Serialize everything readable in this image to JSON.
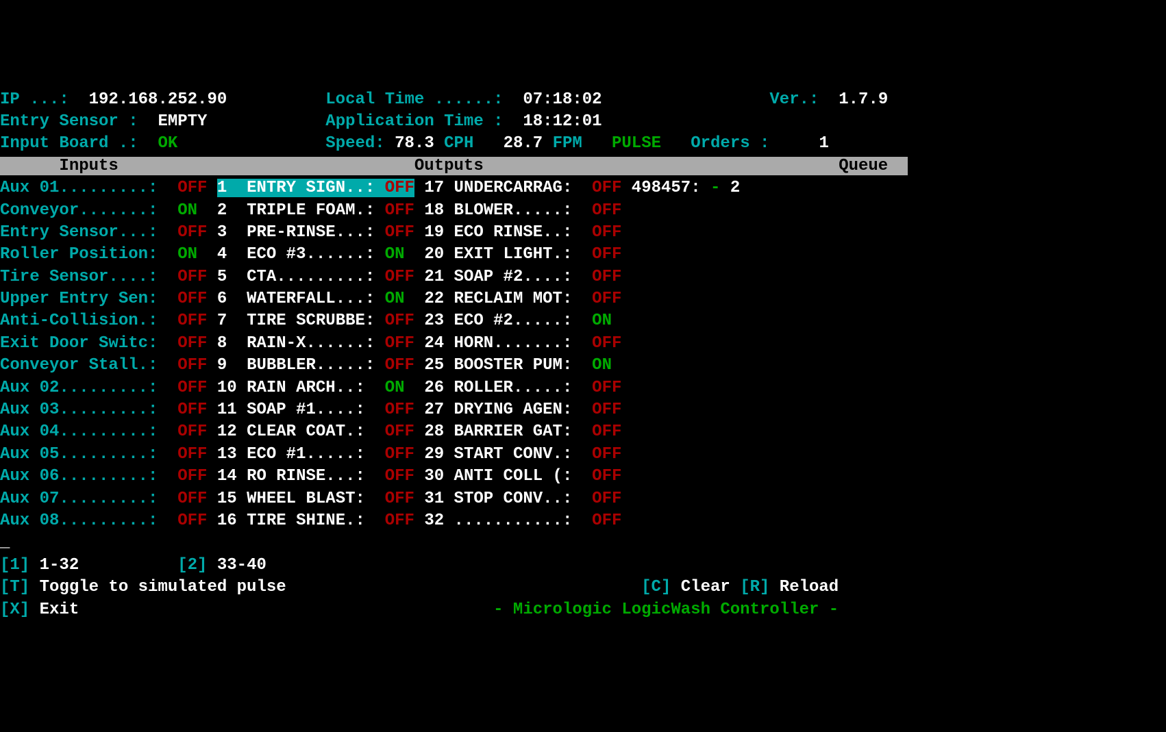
{
  "header": {
    "ip_label": "IP ...:",
    "ip": "192.168.252.90",
    "localtime_label": "Local Time ......:",
    "localtime": "07:18:02",
    "ver_label": "Ver.:",
    "ver": "1.7.9",
    "entry_sensor_label": "Entry Sensor :",
    "entry_sensor": "EMPTY",
    "app_time_label": "Application Time :",
    "app_time": "18:12:01",
    "input_board_label": "Input Board .:",
    "input_board": "OK",
    "speed_label": "Speed:",
    "speed_cph_val": "78.3",
    "speed_cph_unit": "CPH",
    "speed_fpm_val": "28.7",
    "speed_fpm_unit": "FPM",
    "pulse": "PULSE",
    "orders_label": "Orders :",
    "orders": "1"
  },
  "sections": {
    "inputs": "Inputs",
    "outputs": "Outputs",
    "queue": "Queue"
  },
  "inputs": [
    {
      "label": "Aux 01.........:",
      "state": "OFF"
    },
    {
      "label": "Conveyor.......:",
      "state": "ON"
    },
    {
      "label": "Entry Sensor...:",
      "state": "OFF"
    },
    {
      "label": "Roller Position:",
      "state": "ON"
    },
    {
      "label": "Tire Sensor....:",
      "state": "OFF"
    },
    {
      "label": "Upper Entry Sen:",
      "state": "OFF"
    },
    {
      "label": "Anti-Collision.:",
      "state": "OFF"
    },
    {
      "label": "Exit Door Switc:",
      "state": "OFF"
    },
    {
      "label": "Conveyor Stall.:",
      "state": "OFF"
    },
    {
      "label": "Aux 02.........:",
      "state": "OFF"
    },
    {
      "label": "Aux 03.........:",
      "state": "OFF"
    },
    {
      "label": "Aux 04.........:",
      "state": "OFF"
    },
    {
      "label": "Aux 05.........:",
      "state": "OFF"
    },
    {
      "label": "Aux 06.........:",
      "state": "OFF"
    },
    {
      "label": "Aux 07.........:",
      "state": "OFF"
    },
    {
      "label": "Aux 08.........:",
      "state": "OFF"
    }
  ],
  "outputs": [
    {
      "num": "1",
      "label": "ENTRY SIGN..:",
      "state": "OFF"
    },
    {
      "num": "2",
      "label": "TRIPLE FOAM.:",
      "state": "OFF"
    },
    {
      "num": "3",
      "label": "PRE-RINSE...:",
      "state": "OFF"
    },
    {
      "num": "4",
      "label": "ECO #3......:",
      "state": "ON"
    },
    {
      "num": "5",
      "label": "CTA.........:",
      "state": "OFF"
    },
    {
      "num": "6",
      "label": "WATERFALL...:",
      "state": "ON"
    },
    {
      "num": "7",
      "label": "TIRE SCRUBBE:",
      "state": "OFF"
    },
    {
      "num": "8",
      "label": "RAIN-X......:",
      "state": "OFF"
    },
    {
      "num": "9",
      "label": "BUBBLER.....:",
      "state": "OFF"
    },
    {
      "num": "10",
      "label": "RAIN ARCH..:",
      "state": "ON"
    },
    {
      "num": "11",
      "label": "SOAP #1....:",
      "state": "OFF"
    },
    {
      "num": "12",
      "label": "CLEAR COAT.:",
      "state": "OFF"
    },
    {
      "num": "13",
      "label": "ECO #1.....:",
      "state": "OFF"
    },
    {
      "num": "14",
      "label": "RO RINSE...:",
      "state": "OFF"
    },
    {
      "num": "15",
      "label": "WHEEL BLAST:",
      "state": "OFF"
    },
    {
      "num": "16",
      "label": "TIRE SHINE.:",
      "state": "OFF"
    },
    {
      "num": "17",
      "label": "UNDERCARRAG:",
      "state": "OFF"
    },
    {
      "num": "18",
      "label": "BLOWER.....:",
      "state": "OFF"
    },
    {
      "num": "19",
      "label": "ECO RINSE..:",
      "state": "OFF"
    },
    {
      "num": "20",
      "label": "EXIT LIGHT.:",
      "state": "OFF"
    },
    {
      "num": "21",
      "label": "SOAP #2....:",
      "state": "OFF"
    },
    {
      "num": "22",
      "label": "RECLAIM MOT:",
      "state": "OFF"
    },
    {
      "num": "23",
      "label": "ECO #2.....:",
      "state": "ON"
    },
    {
      "num": "24",
      "label": "HORN.......:",
      "state": "OFF"
    },
    {
      "num": "25",
      "label": "BOOSTER PUM:",
      "state": "ON"
    },
    {
      "num": "26",
      "label": "ROLLER.....:",
      "state": "OFF"
    },
    {
      "num": "27",
      "label": "DRYING AGEN:",
      "state": "OFF"
    },
    {
      "num": "28",
      "label": "BARRIER GAT:",
      "state": "OFF"
    },
    {
      "num": "29",
      "label": "START CONV.:",
      "state": "OFF"
    },
    {
      "num": "30",
      "label": "ANTI COLL (:",
      "state": "OFF"
    },
    {
      "num": "31",
      "label": "STOP CONV..:",
      "state": "OFF"
    },
    {
      "num": "32",
      "label": "...........:",
      "state": "OFF"
    }
  ],
  "queue": [
    {
      "id": "498457:",
      "dash": "-",
      "val": "2"
    }
  ],
  "footer": {
    "k1": "[1]",
    "k1txt": "1-32",
    "k2": "[2]",
    "k2txt": "33-40",
    "kt": "[T]",
    "kttxt": "Toggle to simulated pulse",
    "kc": "[C]",
    "kctxt": "Clear",
    "kr": "[R]",
    "krtxt": "Reload",
    "kx": "[X]",
    "kxtxt": "Exit",
    "brand": "- Micrologic LogicWash Controller -"
  }
}
